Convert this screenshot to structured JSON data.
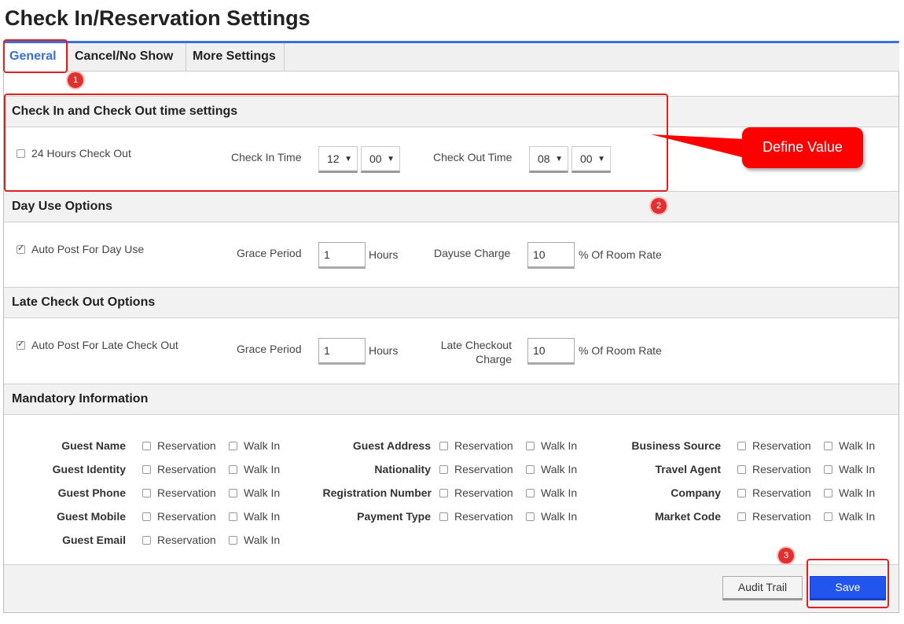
{
  "page": {
    "title": "Check In/Reservation Settings"
  },
  "tabs": [
    {
      "label": "General",
      "active": true
    },
    {
      "label": "Cancel/No Show",
      "active": false
    },
    {
      "label": "More Settings",
      "active": false
    }
  ],
  "checkin_checkout": {
    "heading": "Check In and Check Out time settings",
    "hours_24_label": "24 Hours Check Out",
    "hours_24_checked": false,
    "checkin_label": "Check In Time",
    "checkin_hour": "12",
    "checkin_minute": "00",
    "checkout_label": "Check Out Time",
    "checkout_hour": "08",
    "checkout_minute": "00"
  },
  "day_use": {
    "heading": "Day Use Options",
    "auto_post_label": "Auto Post For Day Use",
    "auto_post_checked": true,
    "grace_label": "Grace Period",
    "grace_value": "1",
    "grace_unit": "Hours",
    "charge_label": "Dayuse Charge",
    "charge_value": "10",
    "charge_unit": "% Of Room Rate"
  },
  "late_checkout": {
    "heading": "Late Check Out Options",
    "auto_post_label": "Auto Post For Late Check Out",
    "auto_post_checked": true,
    "grace_label": "Grace Period",
    "grace_value": "1",
    "grace_unit": "Hours",
    "charge_label_line1": "Late Checkout",
    "charge_label_line2": "Charge",
    "charge_value": "10",
    "charge_unit": "% Of Room Rate"
  },
  "mandatory": {
    "heading": "Mandatory Information",
    "option_reservation": "Reservation",
    "option_walkin": "Walk In",
    "col1": [
      "Guest Name",
      "Guest Identity",
      "Guest Phone",
      "Guest Mobile",
      "Guest Email"
    ],
    "col2": [
      "Guest Address",
      "Nationality",
      "Registration Number",
      "Payment Type"
    ],
    "col3": [
      "Business Source",
      "Travel Agent",
      "Company",
      "Market Code"
    ]
  },
  "footer": {
    "audit_label": "Audit Trail",
    "save_label": "Save"
  },
  "annotations": {
    "callout_text": "Define Value",
    "badge1": "1",
    "badge2": "2",
    "badge3": "3",
    "highlight_color": "#e02020"
  },
  "colors": {
    "accent": "#3a6fd8",
    "save": "#2255ee"
  }
}
